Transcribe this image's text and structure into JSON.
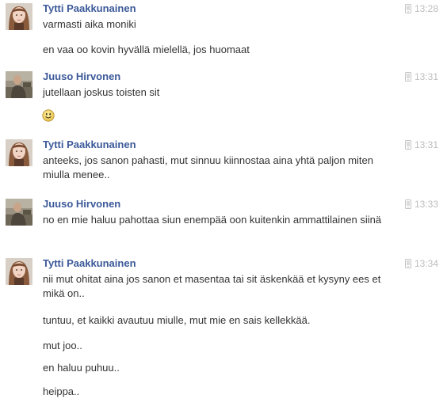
{
  "conversation": {
    "groups": [
      {
        "author": "Tytti Paakkunainen",
        "time": "13:28",
        "avatar": "female-profile-avatar",
        "messages": [
          "varmasti aika moniki",
          "en vaa oo kovin hyvällä mielellä, jos huomaat"
        ]
      },
      {
        "author": "Juuso Hirvonen",
        "time": "13:31",
        "avatar": "male-profile-avatar",
        "messages": [
          "jutellaan joskus toisten sit"
        ],
        "emoticon": "smile-emoticon-icon"
      },
      {
        "author": "Tytti Paakkunainen",
        "time": "13:31",
        "avatar": "female-profile-avatar",
        "messages": [
          "anteeks, jos sanon pahasti, mut sinnuu kiinnostaa aina yhtä paljon miten miulla menee.."
        ]
      },
      {
        "author": "Juuso Hirvonen",
        "time": "13:33",
        "avatar": "male-profile-avatar",
        "messages": [
          "no en mie haluu pahottaa siun enempää oon kuitenkin ammattilainen siinä"
        ]
      },
      {
        "author": "Tytti Paakkunainen",
        "time": "13:34",
        "avatar": "female-profile-avatar",
        "messages": [
          "nii mut ohitat aina jos sanon et masentaa tai sit äskenkää et kysyny ees et mikä on..",
          "tuntuu, et kaikki avautuu miulle, mut mie en sais kellekkää.",
          "mut joo..",
          "en haluu puhuu..",
          "heippa.."
        ]
      }
    ]
  },
  "icons": {
    "sent_from": "mobile-phone-icon"
  },
  "colors": {
    "author_link": "#3b5998",
    "message_text": "#333333",
    "timestamp": "#bdbdbd",
    "background": "#ffffff"
  }
}
